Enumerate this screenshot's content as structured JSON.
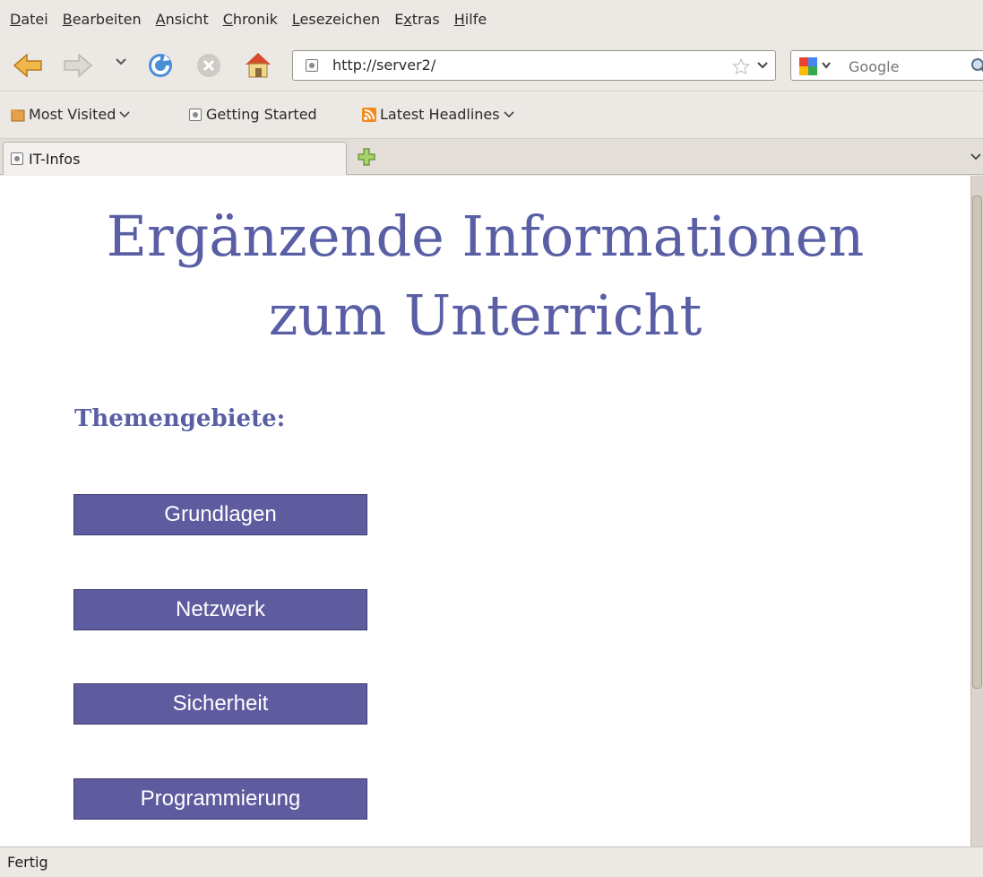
{
  "menu": [
    {
      "access": "D",
      "rest": "atei"
    },
    {
      "access": "B",
      "rest": "earbeiten"
    },
    {
      "access": "A",
      "rest": "nsicht"
    },
    {
      "access": "C",
      "rest": "hronik"
    },
    {
      "access": "L",
      "rest": "esezeichen"
    },
    {
      "pre": "E",
      "access": "x",
      "rest": "tras"
    },
    {
      "access": "H",
      "rest": "ilfe"
    }
  ],
  "toolbar": {
    "url": "http://server2/",
    "search_placeholder": "Google"
  },
  "bookmarks": [
    {
      "label": "Most Visited",
      "icon": "folder-icon",
      "dropdown": true
    },
    {
      "label": "Getting Started",
      "icon": "page-icon",
      "dropdown": false
    },
    {
      "label": "Latest Headlines",
      "icon": "rss-icon",
      "dropdown": true
    }
  ],
  "tab": {
    "label": "IT-Infos"
  },
  "page": {
    "title_line1": "Ergänzende Informationen",
    "title_line2": "zum Unterricht",
    "subtitle": "Themengebiete:",
    "topics": [
      "Grundlagen",
      "Netzwerk",
      "Sicherheit",
      "Programmierung"
    ]
  },
  "status": {
    "text": "Fertig"
  },
  "colors": {
    "accent": "#5a5fa5",
    "button_bg": "#5f5b9f",
    "button_text": "#ffffff"
  }
}
